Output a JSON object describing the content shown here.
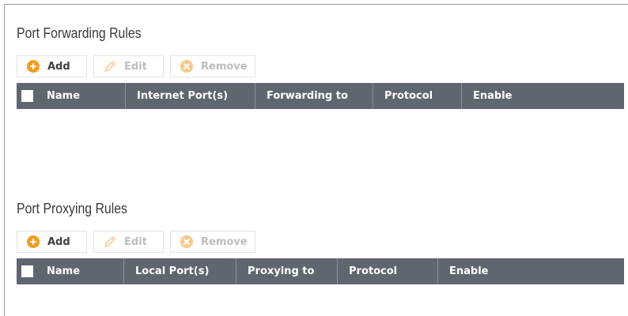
{
  "sections": [
    {
      "title": "Port Forwarding Rules",
      "toolbar": {
        "add": "Add",
        "edit": "Edit",
        "remove": "Remove"
      },
      "columns": [
        "Name",
        "Internet Port(s)",
        "Forwarding to",
        "Protocol",
        "Enable"
      ]
    },
    {
      "title": "Port Proxying Rules",
      "toolbar": {
        "add": "Add",
        "edit": "Edit",
        "remove": "Remove"
      },
      "columns": [
        "Name",
        "Local Port(s)",
        "Proxying to",
        "Protocol",
        "Enable"
      ]
    }
  ],
  "colors": {
    "accent": "#f39c1f",
    "header_bg": "#5f6670",
    "disabled_text": "#bdbdbd",
    "title_text": "#3a3a3a"
  },
  "icons": {
    "add": "plus-circle-icon",
    "edit": "pencil-icon",
    "remove": "x-circle-icon"
  }
}
